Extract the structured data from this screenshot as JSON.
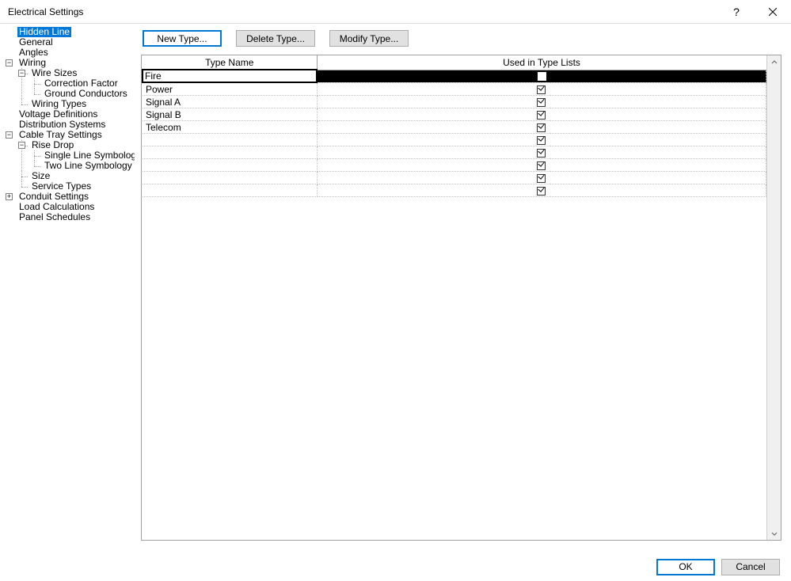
{
  "titlebar": {
    "title": "Electrical Settings",
    "help": "?"
  },
  "tree": {
    "items": [
      {
        "label": "Hidden Line",
        "children": 0,
        "selected": true
      },
      {
        "label": "General"
      },
      {
        "label": "Angles"
      },
      {
        "label": "Wiring",
        "expander": "minus"
      },
      {
        "label": "Wire Sizes",
        "level": 1,
        "expander": "minus"
      },
      {
        "label": "Correction Factor",
        "level": 2
      },
      {
        "label": "Ground Conductors",
        "level": 2
      },
      {
        "label": "Wiring Types",
        "level": 1
      },
      {
        "label": "Voltage Definitions"
      },
      {
        "label": "Distribution Systems"
      },
      {
        "label": "Cable Tray Settings",
        "expander": "minus"
      },
      {
        "label": "Rise Drop",
        "level": 1,
        "expander": "minus"
      },
      {
        "label": "Single Line Symbology",
        "level": 2
      },
      {
        "label": "Two Line Symbology",
        "level": 2
      },
      {
        "label": "Size",
        "level": 1
      },
      {
        "label": "Service Types",
        "level": 1
      },
      {
        "label": "Conduit Settings",
        "expander": "plus"
      },
      {
        "label": "Load Calculations"
      },
      {
        "label": "Panel Schedules"
      }
    ]
  },
  "buttons": {
    "new_type": "New Type...",
    "delete_type": "Delete Type...",
    "modify_type": "Modify Type..."
  },
  "table": {
    "headers": {
      "name": "Type Name",
      "used": "Used in Type Lists"
    },
    "rows": [
      {
        "name": "Fire",
        "checked": true,
        "selected": true
      },
      {
        "name": "Power",
        "checked": true
      },
      {
        "name": "Signal A",
        "checked": true
      },
      {
        "name": "Signal B",
        "checked": true
      },
      {
        "name": "Telecom",
        "checked": true
      },
      {
        "name": "",
        "checked": true
      },
      {
        "name": "",
        "checked": true
      },
      {
        "name": "",
        "checked": true
      },
      {
        "name": "",
        "checked": true
      },
      {
        "name": "",
        "checked": true
      }
    ]
  },
  "footer": {
    "ok": "OK",
    "cancel": "Cancel"
  }
}
